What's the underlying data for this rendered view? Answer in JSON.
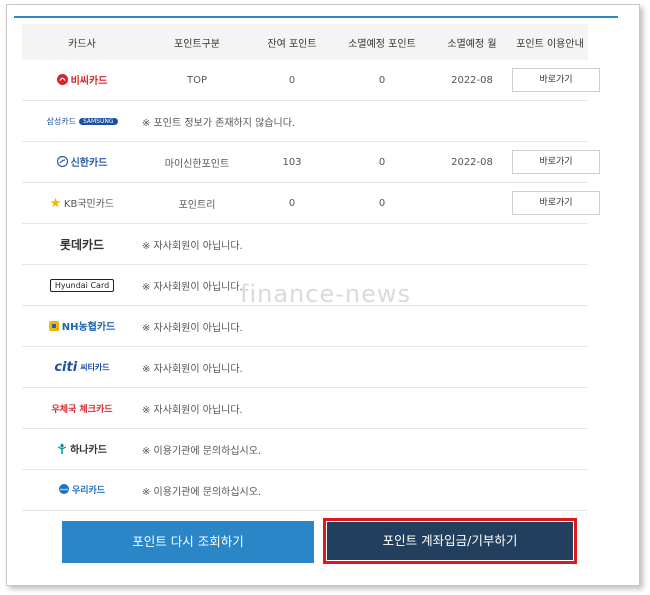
{
  "headers": [
    "카드사",
    "포인트구분",
    "잔여 포인트",
    "소멸예정 포인트",
    "소멸예정 월",
    "포인트 이용안내"
  ],
  "rows": [
    {
      "card": "비씨카드",
      "brand_color": "#d6242b",
      "icon": "bc-card-logo",
      "point_type": "TOP",
      "balance": "0",
      "expiring": "0",
      "month": "2022-08",
      "action": "바로가기",
      "message": ""
    },
    {
      "card": "삼성카드",
      "card_sub": "SAMSUNG",
      "brand_color": "#1a4fa0",
      "icon": "samsung-card-logo",
      "message": "※ 포인트 정보가 존재하지 않습니다."
    },
    {
      "card": "신한카드",
      "brand_color": "#2b5aa8",
      "icon": "shinhan-card-logo",
      "point_type": "마이신한포인트",
      "balance": "103",
      "expiring": "0",
      "month": "2022-08",
      "action": "바로가기",
      "message": ""
    },
    {
      "card": "KB국민카드",
      "brand_color": "#f2b500",
      "icon": "kb-card-logo",
      "point_type": "포인트리",
      "balance": "0",
      "expiring": "0",
      "month": "",
      "action": "바로가기",
      "message": ""
    },
    {
      "card": "롯데카드",
      "brand_color": "#333333",
      "icon": "lotte-card-logo",
      "message": "※ 자사회원이 아닙니다."
    },
    {
      "card": "Hyundai Card",
      "brand_color": "#222222",
      "icon": "hyundai-card-logo",
      "message": "※ 자사회원이 아닙니다."
    },
    {
      "card": "NH농협카드",
      "brand_color": "#1a66b0",
      "icon": "nh-card-logo",
      "message": "※ 자사회원이 아닙니다."
    },
    {
      "card": "씨티카드",
      "card_sub": "citi",
      "brand_color": "#1e4fa0",
      "icon": "citi-card-logo",
      "message": "※ 자사회원이 아닙니다."
    },
    {
      "card": "우체국 체크카드",
      "brand_color": "#d4282e",
      "icon": "post-card-logo",
      "message": "※ 자사회원이 아닙니다."
    },
    {
      "card": "하나카드",
      "brand_color": "#009490",
      "icon": "hana-card-logo",
      "message": "※ 이용기관에 문의하십시오."
    },
    {
      "card": "우리카드",
      "brand_color": "#1f6fc0",
      "icon": "woori-card-logo",
      "message": "※ 이용기관에 문의하십시오."
    }
  ],
  "buttons": {
    "refresh": "포인트 다시 조회하기",
    "deposit": "포인트 계좌입금/기부하기"
  },
  "watermark": "finance-news",
  "colors": {
    "accent": "#2a86c7",
    "dark_button": "#22405e",
    "highlight": "#e0191b"
  }
}
